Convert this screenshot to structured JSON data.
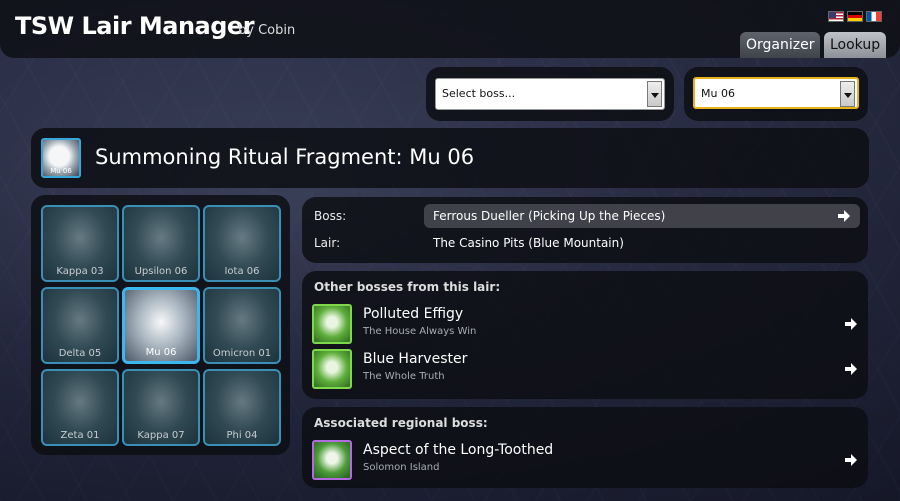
{
  "app": {
    "title": "TSW Lair Manager",
    "byline": "by Cobin",
    "languages": [
      "English",
      "Deutsch",
      "Français"
    ],
    "tabs": [
      {
        "label": "Organizer",
        "active": false
      },
      {
        "label": "Lookup",
        "active": true
      }
    ]
  },
  "selects": {
    "boss": {
      "value": "Select boss..."
    },
    "fragment": {
      "value": "Mu 06"
    }
  },
  "item": {
    "icon_label": "Mu 06",
    "title": "Summoning Ritual Fragment: Mu 06"
  },
  "fragments": [
    {
      "label": "Kappa 03",
      "active": false
    },
    {
      "label": "Upsilon 06",
      "active": false
    },
    {
      "label": "Iota 06",
      "active": false
    },
    {
      "label": "Delta 05",
      "active": false
    },
    {
      "label": "Mu 06",
      "active": true
    },
    {
      "label": "Omicron 01",
      "active": false
    },
    {
      "label": "Zeta 01",
      "active": false
    },
    {
      "label": "Kappa 07",
      "active": false
    },
    {
      "label": "Phi 04",
      "active": false
    }
  ],
  "info": {
    "boss_key": "Boss:",
    "boss_value": "Ferrous Dueller (Picking Up the Pieces)",
    "lair_key": "Lair:",
    "lair_value": "The Casino Pits (Blue Mountain)"
  },
  "other_bosses": {
    "title": "Other bosses from this lair:",
    "items": [
      {
        "name": "Polluted Effigy",
        "sub": "The House Always Win"
      },
      {
        "name": "Blue Harvester",
        "sub": "The Whole Truth"
      }
    ]
  },
  "regional": {
    "title": "Associated regional boss:",
    "items": [
      {
        "name": "Aspect of the Long-Toothed",
        "sub": "Solomon Island"
      }
    ]
  },
  "colors": {
    "accent_blue": "#37a6d8",
    "select_focus": "#e8b21a",
    "boss_green": "#7fd84a",
    "regional_purple": "#b06be0"
  }
}
